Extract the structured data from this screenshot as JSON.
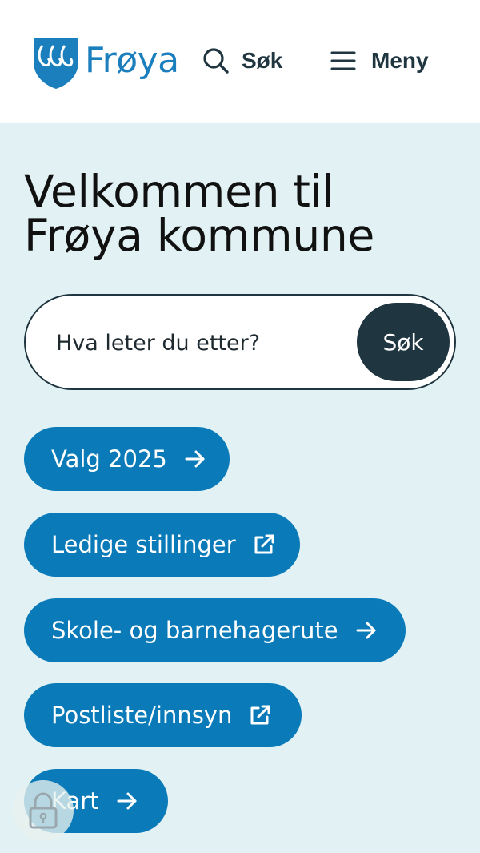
{
  "header": {
    "logo_text": "Frøya",
    "logo_icon": "municipal-coat-of-arms-shield",
    "search_label": "Søk",
    "menu_label": "Meny"
  },
  "hero": {
    "title": "Velkommen til Frøya kommune"
  },
  "search": {
    "placeholder": "Hva leter du etter?",
    "button_label": "Søk"
  },
  "quick_links": [
    {
      "label": "Valg 2025",
      "icon": "arrow-right-icon"
    },
    {
      "label": "Ledige stillinger",
      "icon": "external-link-icon"
    },
    {
      "label": "Skole- og barnehagerute",
      "icon": "arrow-right-icon"
    },
    {
      "label": "Postliste/innsyn",
      "icon": "external-link-icon"
    },
    {
      "label": "Kart",
      "icon": "arrow-right-icon"
    }
  ],
  "colors": {
    "brand_blue": "#0a7ab8",
    "dark": "#1f3540",
    "page_background": "#e2f2f4",
    "header_background": "#ffffff"
  }
}
